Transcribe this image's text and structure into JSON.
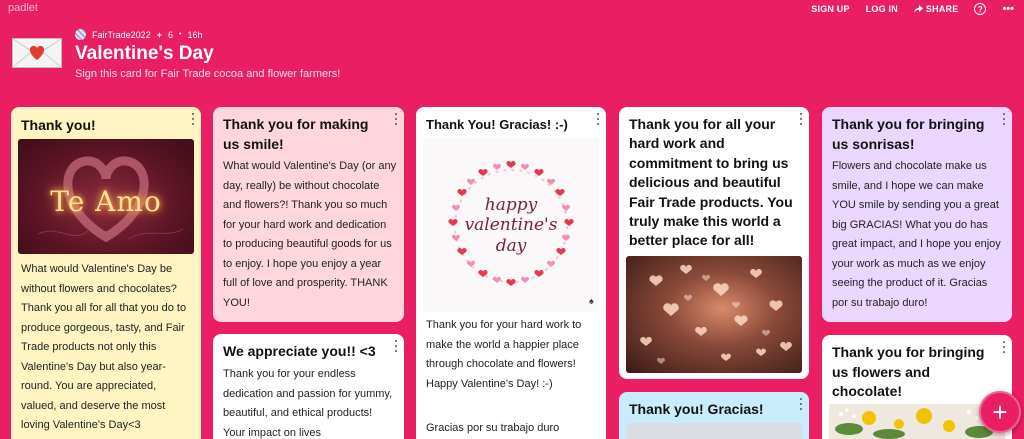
{
  "app": {
    "brand": "padlet"
  },
  "nav": {
    "signup": "SIGN UP",
    "login": "LOG IN",
    "share": "SHARE",
    "help": "?",
    "more": "•••"
  },
  "header": {
    "author": "FairTrade2022",
    "likes_icon": "+",
    "likes": "6",
    "time": "16h",
    "title": "Valentine's Day",
    "subtitle": "Sign this card for Fair Trade cocoa and flower farmers!"
  },
  "posts": {
    "c1": {
      "title": "Thank you!",
      "image_text": "Te Amo",
      "body": "What would Valentine's Day be without flowers and chocolates? Thank you all for all that you do to produce gorgeous, tasty, and Fair Trade products not only this Valentine's Day but also year-round. You are appreciated, valued, and deserve the most loving Valentine's Day<3"
    },
    "c2": {
      "title": "Thank you for making us smile!",
      "body": "What would Valentine's Day (or any day, really) be without chocolate and flowers?! Thank you so much for your hard work and dedication to producing beautiful goods for us to enjoy. I hope you enjoy a year full of love and prosperity. THANK YOU!"
    },
    "c3": {
      "title": "We appreciate you!! <3",
      "body": "Thank you for your endless dedication and passion for yummy, beautiful, and ethical products! Your impact on lives"
    },
    "c4": {
      "title": "Thank You! Gracias! :-)",
      "image_text_1": "happy",
      "image_text_2": "valentine's",
      "image_text_3": "day",
      "body": "Thank you for your hard work to make the world a happier place through chocolate and flowers! Happy Valentine's Day! :-)",
      "body2": "Gracias por su trabajo duro"
    },
    "c5": {
      "title": "Thank you for all your hard work and commitment to bring us delicious and beautiful Fair Trade products. You truly make this world a better place for all!"
    },
    "c6": {
      "title": "Thank you! Gracias!"
    },
    "c7": {
      "title": "Thank you for bringing us sonrisas!",
      "body": "Flowers and chocolate make us smile, and I hope we can make YOU smile by sending you a great big GRACIAS! What you do has great impact, and I hope you enjoy your work as much as we enjoy seeing the product of it. Gracias por su trabajo duro!"
    },
    "c8": {
      "title": "Thank you for bringing us flowers and chocolate!"
    }
  },
  "fab": {
    "label": "+"
  },
  "colors": {
    "background": "#e91e63",
    "card_yellow": "#fff4c2",
    "card_pink": "#ffd6dc",
    "card_white": "#ffffff",
    "card_lavender": "#ead6ff",
    "card_blue": "#c8ecfb"
  }
}
